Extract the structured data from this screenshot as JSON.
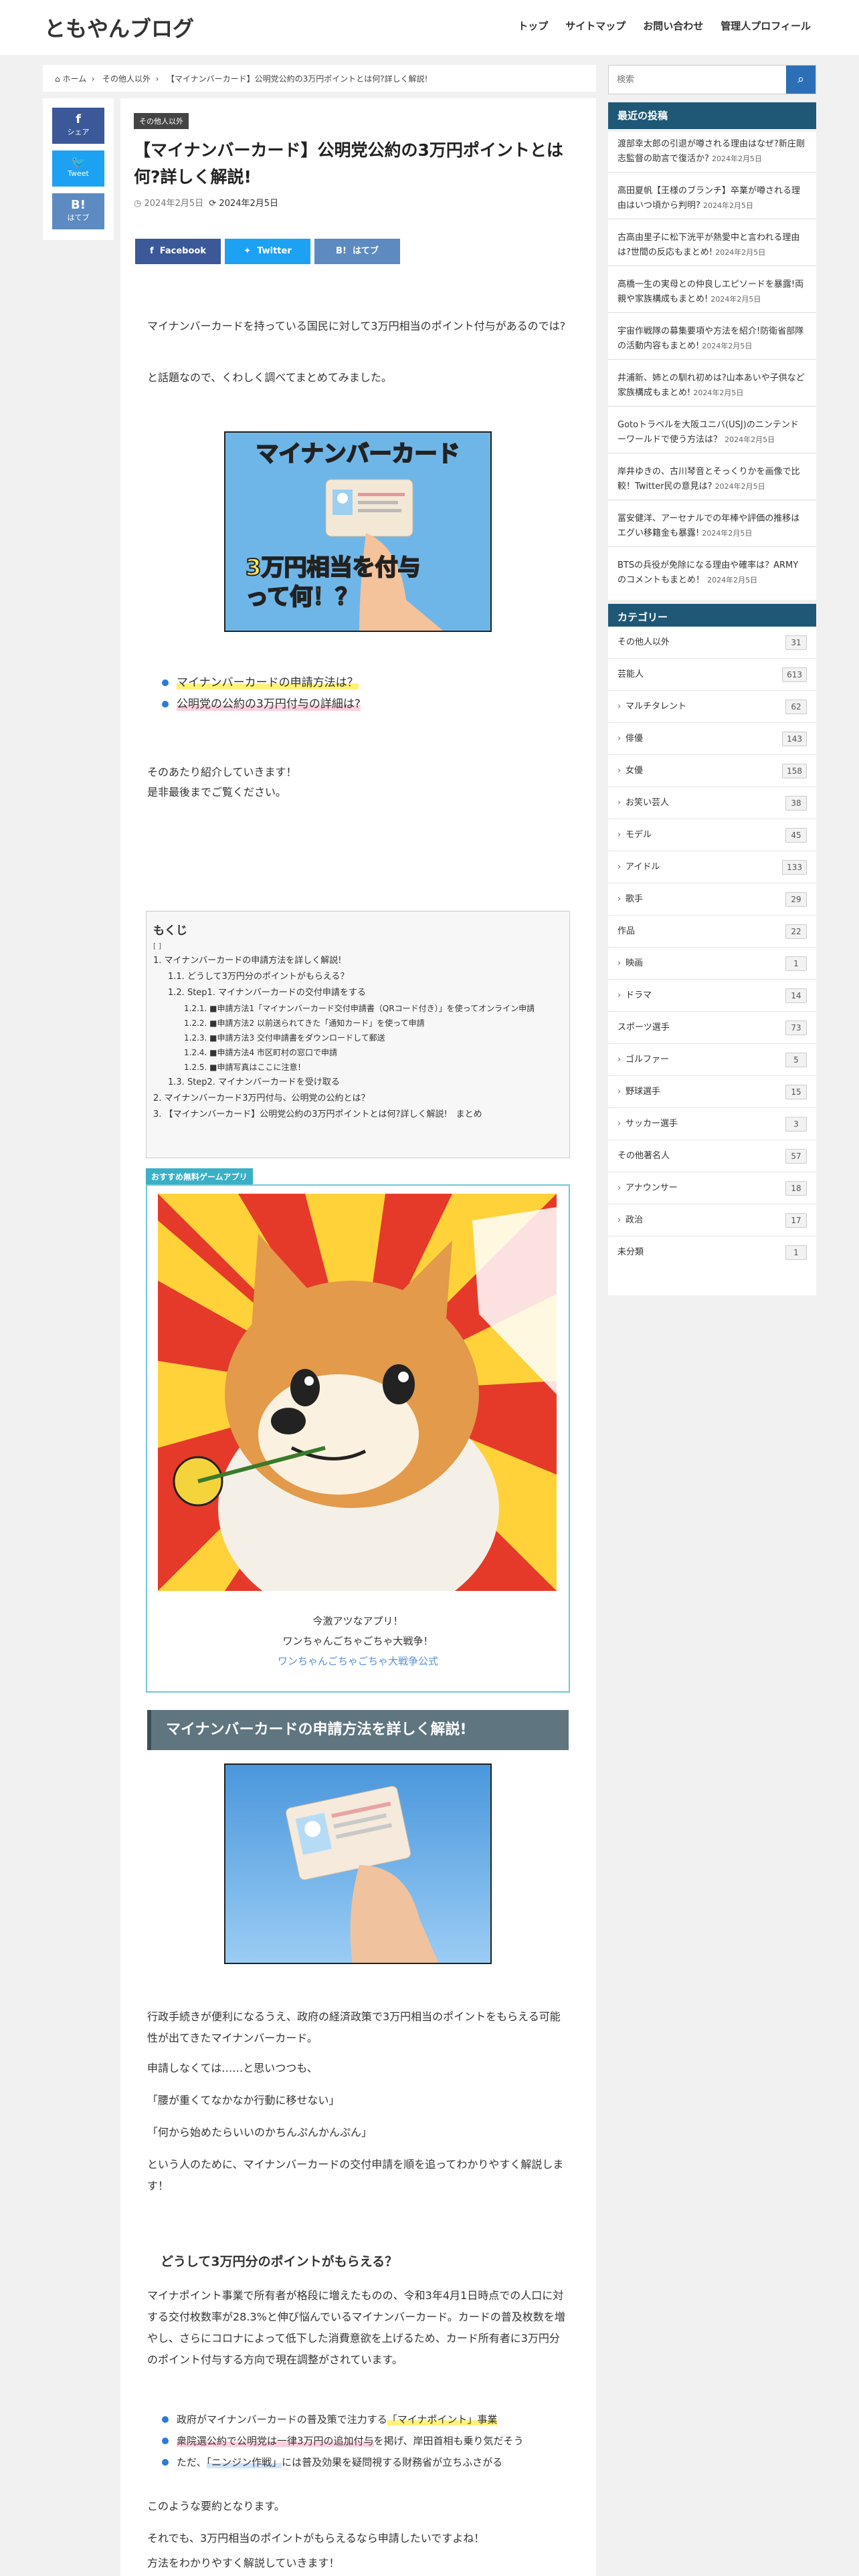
{
  "site": {
    "title": "ともやんブログ"
  },
  "nav": [
    "トップ",
    "サイトマップ",
    "お問い合わせ",
    "管理人プロフィール"
  ],
  "breadcrumb": {
    "home": "ホーム",
    "cat": "その他人以外",
    "current": "【マイナンバーカード】公明党公約の3万円ポイントとは何?詳しく解説!"
  },
  "share_side": [
    {
      "icon": "f",
      "label": "シェア",
      "color": "#3b5998"
    },
    {
      "icon": "🐦",
      "label": "Tweet",
      "color": "#1da1f2"
    },
    {
      "icon": "B!",
      "label": "はてブ",
      "color": "#5d8ac1"
    }
  ],
  "article": {
    "category": "その他人以外",
    "title": "【マイナンバーカード】公明党公約の3万円ポイントとは何?詳しく解説!",
    "published": "2024年2月5日",
    "updated": "2024年2月5日",
    "share": [
      "Facebook",
      "Twitter",
      "はてブ"
    ],
    "intro1": "マイナンバーカードを持っている国民に対して3万円相当のポイント付与があるのでは?",
    "intro2": "と話題なので、くわしく調べてまとめてみました。",
    "eyecatch_title": "マイナンバーカード",
    "eyecatch_sub1": "3万円相当を付与",
    "eyecatch_sub2": "って何！？",
    "bullets": [
      "マイナンバーカードの申請方法は？",
      "公明党の公約の3万円付与の詳細は?"
    ],
    "intro3": "そのあたり紹介していきます！",
    "intro4": "是非最後までご覧ください。",
    "toc": {
      "title": "もくじ",
      "toggle": "[ ]",
      "items": [
        {
          "level": 1,
          "text": "1. マイナンバーカードの申請方法を詳しく解説!"
        },
        {
          "level": 2,
          "text": "1.1. どうして3万円分のポイントがもらえる？"
        },
        {
          "level": 2,
          "text": "1.2. Step1. マイナンバーカードの交付申請をする"
        },
        {
          "level": 3,
          "text": "1.2.1. ■申請方法1「マイナンバーカード交付申請書（QRコード付き）」を使ってオンライン申請"
        },
        {
          "level": 3,
          "text": "1.2.2. ■申請方法2 以前送られてきた「通知カード」を使って申請"
        },
        {
          "level": 3,
          "text": "1.2.3. ■申請方法3 交付申請書をダウンロードして郵送"
        },
        {
          "level": 3,
          "text": "1.2.4. ■申請方法4 市区町村の窓口で申請"
        },
        {
          "level": 3,
          "text": "1.2.5. ■申請写真はここに注意！"
        },
        {
          "level": 2,
          "text": "1.3. Step2. マイナンバーカードを受け取る"
        },
        {
          "level": 1,
          "text": "2. マイナンバーカード3万円付与、公明党の公約とは？"
        },
        {
          "level": 1,
          "text": "3. 【マイナンバーカード】公明党公約の3万円ポイントとは何?詳しく解説!　まとめ"
        }
      ]
    },
    "game": {
      "tag": "おすすめ無料ゲームアプリ",
      "line1": "今激アツなアプリ！",
      "line2": "ワンちゃんごちゃごちゃ大戦争！",
      "link": "ワンちゃんごちゃごちゃ大戦争公式"
    },
    "h2": "マイナンバーカードの申請方法を詳しく解説!",
    "body1": "行政手続きが便利になるうえ、政府の経済政策で3万円相当のポイントをもらえる可能性が出てきたマイナンバーカード。",
    "body2": "申請しなくては……と思いつつも、",
    "body3": "「腰が重くてなかなか行動に移せない」",
    "body4": "「何から始めたらいいのかちんぷんかんぷん」",
    "body5": "という人のために、マイナンバーカードの交付申請を順を追ってわかりやすく解説します！",
    "h3": "どうして3万円分のポイントがもらえる？",
    "body6": "マイナポイント事業で所有者が格段に増えたものの、令和3年4月1日時点での人口に対する交付枚数率が28.3%と伸び悩んでいるマイナンバーカード。カードの普及枚数を増やし、さらにコロナによって低下した消費意欲を上げるため、カード所有者に3万円分のポイント付与する方向で現在調整がされています。",
    "b2_1a": "政府がマイナンバーカードの普及策で注力する",
    "b2_1b": "「マイナポイント」事業",
    "b2_2a": "衆院選公約で公明党は一律3万円の追加付与",
    "b2_2b": "を掲げ、岸田首相も乗り気だそう",
    "b2_3a": "ただ、",
    "b2_3b": "「ニンジン作戦」",
    "b2_3c": "には普及効果を疑問視する財務省が立ちふさがる",
    "body7": "このような要約となります。",
    "body8": "それでも、3万円相当のポイントがもらえるなら申請したいですよね！",
    "body9": "方法をわかりやすく解説していきます！"
  },
  "sidebar": {
    "search_placeholder": "検索",
    "recent_title": "最近の投稿",
    "recent": [
      {
        "title": "渡部幸太郎の引退が噂される理由はなぜ?新庄剛志監督の助言で復活か?",
        "date": "2024年2月5日"
      },
      {
        "title": "高田夏帆【王様のブランチ】卒業が噂される理由はいつ頃から判明?",
        "date": "2024年2月5日"
      },
      {
        "title": "古高由里子に松下洸平が熱愛中と言われる理由は?世間の反応もまとめ!",
        "date": "2024年2月5日"
      },
      {
        "title": "高橋一生の実母との仲良しエピソードを暴露!両親や家族構成もまとめ!",
        "date": "2024年2月5日"
      },
      {
        "title": "宇宙作戦隊の募集要項や方法を紹介!防衛省部隊の活動内容もまとめ!",
        "date": "2024年2月5日"
      },
      {
        "title": "井浦新、姉との馴れ初めは?山本あいや子供など家族構成もまとめ!",
        "date": "2024年2月5日"
      },
      {
        "title": "Gotoトラベルを大阪ユニバ(USJ)のニンテンドーワールドで使う方法は？",
        "date": "2024年2月5日"
      },
      {
        "title": "岸井ゆきの、古川琴音とそっくりかを画像で比較！Twitter民の意見は?",
        "date": "2024年2月5日"
      },
      {
        "title": "冨安健洋、アーセナルでの年棒や評価の推移はエグい移籍金も暴露!",
        "date": "2024年2月5日"
      },
      {
        "title": "BTSの兵役が免除になる理由や確率は？ARMYのコメントもまとめ！",
        "date": "2024年2月5日"
      }
    ],
    "cat_title": "カテゴリー",
    "cats": [
      {
        "name": "その他人以外",
        "count": "31",
        "sub": false
      },
      {
        "name": "芸能人",
        "count": "613",
        "sub": false
      },
      {
        "name": "マルチタレント",
        "count": "62",
        "sub": true
      },
      {
        "name": "俳優",
        "count": "143",
        "sub": true
      },
      {
        "name": "女優",
        "count": "158",
        "sub": true
      },
      {
        "name": "お笑い芸人",
        "count": "38",
        "sub": true
      },
      {
        "name": "モデル",
        "count": "45",
        "sub": true
      },
      {
        "name": "アイドル",
        "count": "133",
        "sub": true
      },
      {
        "name": "歌手",
        "count": "29",
        "sub": true
      },
      {
        "name": "作品",
        "count": "22",
        "sub": false
      },
      {
        "name": "映画",
        "count": "1",
        "sub": true
      },
      {
        "name": "ドラマ",
        "count": "14",
        "sub": true
      },
      {
        "name": "スポーツ選手",
        "count": "73",
        "sub": false
      },
      {
        "name": "ゴルファー",
        "count": "5",
        "sub": true
      },
      {
        "name": "野球選手",
        "count": "15",
        "sub": true
      },
      {
        "name": "サッカー選手",
        "count": "3",
        "sub": true
      },
      {
        "name": "その他著名人",
        "count": "57",
        "sub": false
      },
      {
        "name": "アナウンサー",
        "count": "18",
        "sub": true
      },
      {
        "name": "政治",
        "count": "17",
        "sub": true
      },
      {
        "name": "未分類",
        "count": "1",
        "sub": false
      }
    ]
  }
}
